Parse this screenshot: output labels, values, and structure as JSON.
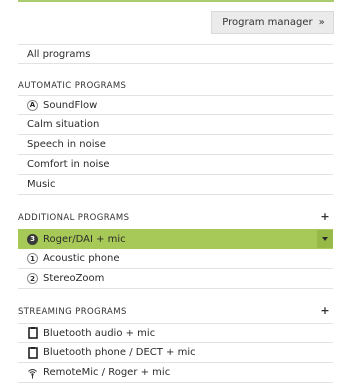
{
  "header_button": {
    "label": "Program manager",
    "chevron": "»"
  },
  "all_programs": {
    "label": "All programs"
  },
  "automatic": {
    "title": "AUTOMATIC PROGRAMS",
    "items": [
      {
        "label": "SoundFlow",
        "badge": "A"
      },
      {
        "label": "Calm situation"
      },
      {
        "label": "Speech in noise"
      },
      {
        "label": "Comfort in noise"
      },
      {
        "label": "Music"
      }
    ]
  },
  "additional": {
    "title": "ADDITIONAL PROGRAMS",
    "add_symbol": "+",
    "items": [
      {
        "label": "Roger/DAI + mic",
        "badge": "3",
        "selected": true
      },
      {
        "label": "Acoustic phone",
        "badge": "1"
      },
      {
        "label": "StereoZoom",
        "badge": "2"
      }
    ]
  },
  "streaming": {
    "title": "STREAMING PROGRAMS",
    "add_symbol": "+",
    "items": [
      {
        "label": "Bluetooth audio + mic",
        "icon": "bluetooth-device-icon"
      },
      {
        "label": "Bluetooth phone / DECT + mic",
        "icon": "bluetooth-device-icon"
      },
      {
        "label": "RemoteMic / Roger + mic",
        "icon": "wireless-mic-icon"
      }
    ]
  },
  "colors": {
    "accent": "#a7c957",
    "accent_dark": "#97b947",
    "top_line": "#a9cc6e"
  }
}
